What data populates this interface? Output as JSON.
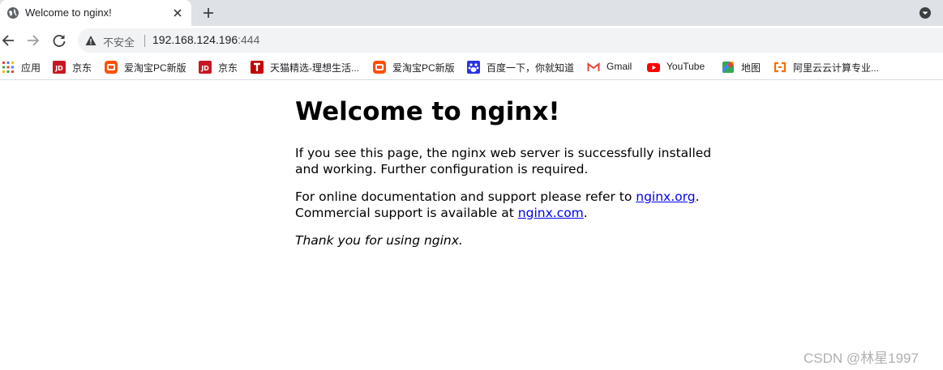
{
  "tab": {
    "title": "Welcome to nginx!"
  },
  "omnibox": {
    "security_text": "不安全",
    "url_host": "192.168.124.196",
    "url_port": ":444"
  },
  "bookmarks": [
    {
      "label": "应用",
      "icon": "apps-grid-icon"
    },
    {
      "label": "京东",
      "icon": "jd-logo-icon",
      "color": "#c91623"
    },
    {
      "label": "爱淘宝PC新版",
      "icon": "taobao-logo-icon",
      "color": "#ff5000"
    },
    {
      "label": "京东",
      "icon": "jd-logo-icon",
      "color": "#c91623"
    },
    {
      "label": "天猫精选-理想生活...",
      "icon": "tmall-logo-icon",
      "color": "#c40000"
    },
    {
      "label": "爱淘宝PC新版",
      "icon": "taobao-logo-icon",
      "color": "#ff5000"
    },
    {
      "label": "百度一下，你就知道",
      "icon": "baidu-logo-icon",
      "color": "#2932e1"
    },
    {
      "label": "Gmail",
      "icon": "gmail-logo-icon"
    },
    {
      "label": "YouTube",
      "icon": "youtube-logo-icon",
      "color": "#ff0000"
    },
    {
      "label": "地图",
      "icon": "maps-logo-icon"
    },
    {
      "label": "阿里云云计算专业...",
      "icon": "aliyun-logo-icon",
      "color": "#ff6a00"
    }
  ],
  "page": {
    "heading": "Welcome to nginx!",
    "para1": "If you see this page, the nginx web server is successfully installed and working. Further configuration is required.",
    "para2_pre": "For online documentation and support please refer to ",
    "link1": "nginx.org",
    "para2_mid": ".",
    "para2_line2_pre": "Commercial support is available at ",
    "link2": "nginx.com",
    "para2_end": ".",
    "thanks": "Thank you for using nginx."
  },
  "watermark": "CSDN @林星1997"
}
